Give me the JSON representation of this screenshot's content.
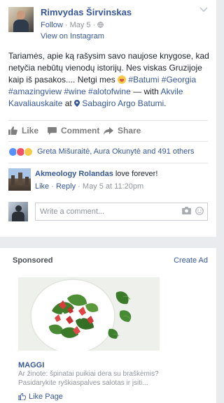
{
  "post": {
    "author": "Rimvydas Širvinskas",
    "follow": "Follow",
    "date": "May 5",
    "separator": "·",
    "view_on": "View on Instagram",
    "text_part1": "Tariamės, apie ką rašysim savo naujose knygose, kad netyčia nebūtų vienodų istorijų. Nes viskas Gruzijoje kaip iš pasakos.... Netgi mes ",
    "tags": "#Batumi #Georgia #amazingview #wine #alotofwine",
    "with_text": " — with ",
    "with_person": "Akvile Kavaliauskaite",
    "at_text": " at ",
    "place": "Sabagiro Argo Batumi",
    "period": "."
  },
  "actions": {
    "like": "Like",
    "comment": "Comment",
    "share": "Share"
  },
  "reactions": {
    "summary": "Greta Mišuraitė, Aura Okunytė and 491 others"
  },
  "comment": {
    "author": "Akmeology Rolandas",
    "text": "love forever!",
    "like": "Like",
    "dot": "·",
    "reply": "Reply",
    "time": "May 5 at 11:20pm"
  },
  "write_comment": {
    "placeholder": "Write a comment..."
  },
  "sponsored": {
    "header": "Sponsored",
    "create_ad": "Create Ad",
    "ad_title": "MAGGI",
    "ad_description": "Ar žinote: špinatai puikiai dera su braškėmis? Pasidarykite ryškiaspalves salotas ir įsiti...",
    "like_page": "Like Page"
  }
}
